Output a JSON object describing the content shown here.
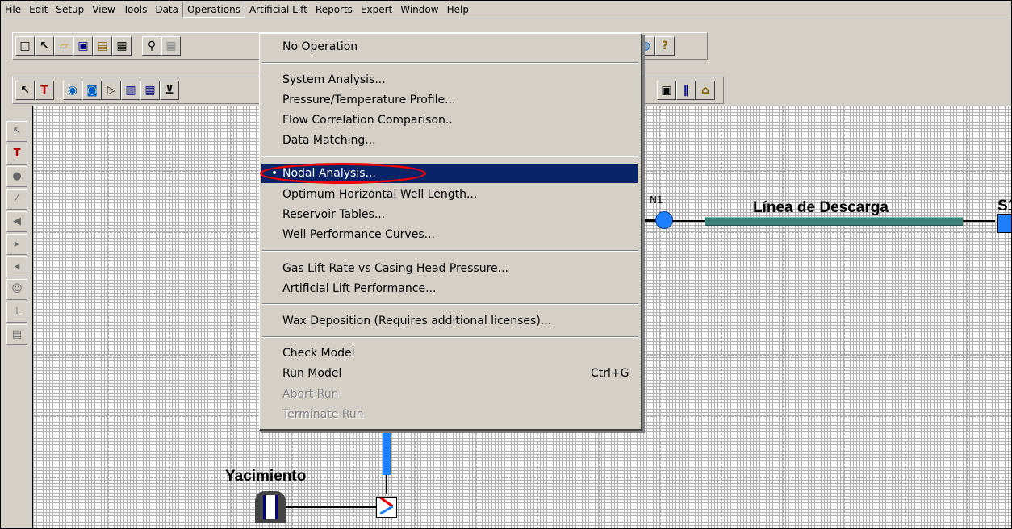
{
  "menubar": {
    "items": [
      "File",
      "Edit",
      "Setup",
      "View",
      "Tools",
      "Data",
      "Operations",
      "Artificial Lift",
      "Reports",
      "Expert",
      "Window",
      "Help"
    ],
    "open_menu": "Operations"
  },
  "operations_menu": {
    "no_operation": "No Operation",
    "system_analysis": "System Analysis...",
    "pressure_temperature_profile": "Pressure/Temperature Profile...",
    "flow_correlation_comparison": "Flow Correlation Comparison..",
    "data_matching": "Data Matching...",
    "nodal_analysis": "Nodal Analysis...",
    "optimum_horizontal_well_length": "Optimum Horizontal Well Length...",
    "reservoir_tables": "Reservoir Tables...",
    "well_performance_curves": "Well Performance Curves...",
    "gas_lift_rate": "Gas Lift Rate vs Casing Head Pressure...",
    "artificial_lift_performance": "Artificial Lift Performance...",
    "wax_deposition": "Wax Deposition (Requires additional licenses)...",
    "check_model": "Check Model",
    "run_model": "Run Model",
    "run_model_shortcut": "Ctrl+G",
    "abort_run": "Abort Run",
    "terminate_run": "Terminate Run",
    "selected_marker": "•"
  },
  "canvas": {
    "node_n1_label": "N1",
    "flowline_label": "Línea de Descarga",
    "sink_label": "S1",
    "reservoir_label": "Yacimiento"
  },
  "colors": {
    "selection": "#0a246a",
    "annotation": "#ee0000",
    "node": "#1e7fff",
    "flowline": "#3f7f7a"
  }
}
